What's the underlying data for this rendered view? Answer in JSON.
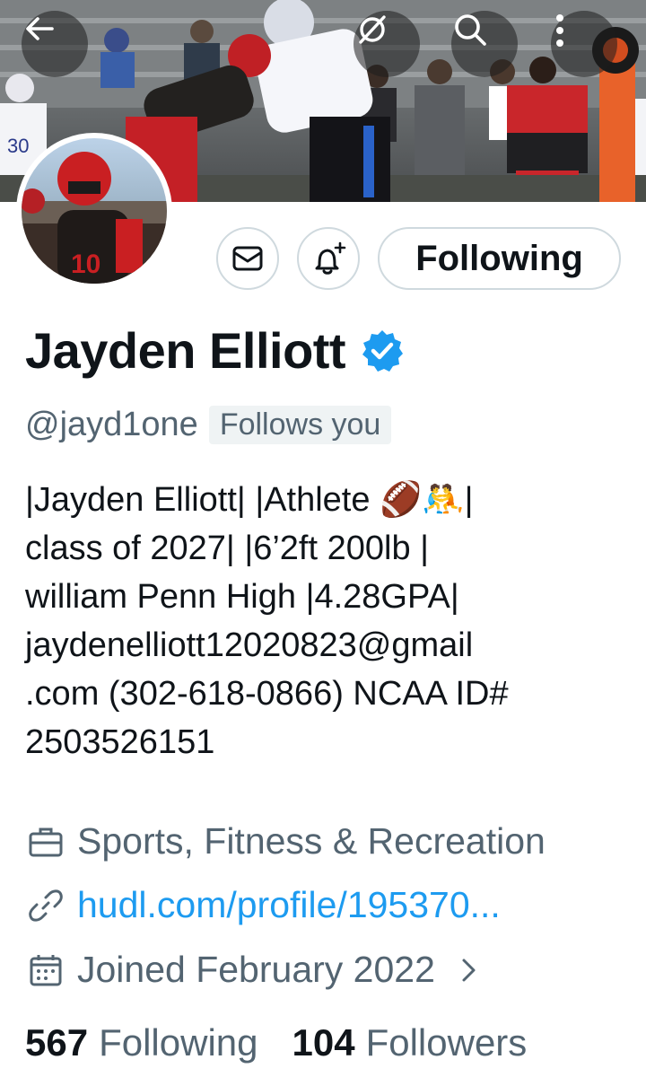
{
  "profile": {
    "name": "Jayden Elliott",
    "handle": "@jayd1one",
    "follows_you": "Follows you",
    "follow_button": "Following",
    "bio_lines": [
      "|Jayden Elliott| |Athlete 🏈🤼|",
      "class of 2027| |6’2ft 200lb |",
      "william Penn High |4.28GPA|",
      "jaydenelliott12020823@gmail",
      ".com (302-618-0866) NCAA ID#",
      "2503526151"
    ],
    "category": "Sports, Fitness & Recreation",
    "website": "hudl.com/profile/195370...",
    "joined": "Joined February 2022",
    "following_count": "567",
    "following_label": "Following",
    "followers_count": "104",
    "followers_label": "Followers"
  },
  "icons": {
    "back": "arrow-left-icon",
    "hide": "eye-slash-icon",
    "search": "search-icon",
    "more": "more-vertical-icon",
    "message": "envelope-icon",
    "notify": "bell-plus-icon",
    "verified": "verified-badge-icon",
    "category": "briefcase-icon",
    "link": "link-icon",
    "calendar": "calendar-icon"
  },
  "colors": {
    "accent": "#1d9bf0",
    "secondary_text": "#536471",
    "border": "#cfd9de"
  }
}
